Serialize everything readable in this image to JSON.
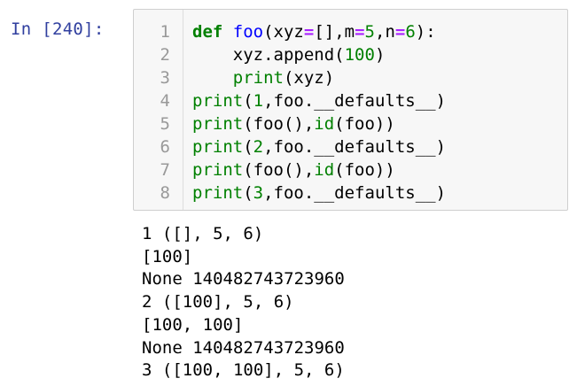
{
  "cell": {
    "prompt": "In [240]:",
    "line_numbers": [
      "1",
      "2",
      "3",
      "4",
      "5",
      "6",
      "7",
      "8"
    ],
    "code": {
      "l1": {
        "kw": "def",
        "fn": "foo",
        "a": "(xyz",
        "eq1": "=",
        "b": "[],m",
        "eq2": "=",
        "n5": "5",
        "c": ",n",
        "eq3": "=",
        "n6": "6",
        "d": "):"
      },
      "l2": {
        "indent": "    ",
        "text": "xyz.append(",
        "num": "100",
        "close": ")"
      },
      "l3": {
        "indent": "    ",
        "bi": "print",
        "text": "(xyz)"
      },
      "l4": {
        "bi": "print",
        "a": "(",
        "num": "1",
        "b": ",foo.__defaults__)"
      },
      "l5": {
        "bi": "print",
        "a": "(foo(),",
        "bi2": "id",
        "b": "(foo))"
      },
      "l6": {
        "bi": "print",
        "a": "(",
        "num": "2",
        "b": ",foo.__defaults__)"
      },
      "l7": {
        "bi": "print",
        "a": "(foo(),",
        "bi2": "id",
        "b": "(foo))"
      },
      "l8": {
        "bi": "print",
        "a": "(",
        "num": "3",
        "b": ",foo.__defaults__)"
      }
    }
  },
  "output": {
    "lines": [
      "1 ([], 5, 6)",
      "[100]",
      "None 140482743723960",
      "2 ([100], 5, 6)",
      "[100, 100]",
      "None 140482743723960",
      "3 ([100, 100], 5, 6)"
    ]
  },
  "colors": {
    "prompt": "#303f9f",
    "keyword": "#008000",
    "function_name": "#0000ff",
    "operator": "#aa22ff",
    "cell_background": "#f7f7f7",
    "cell_border": "#cfcfcf"
  }
}
